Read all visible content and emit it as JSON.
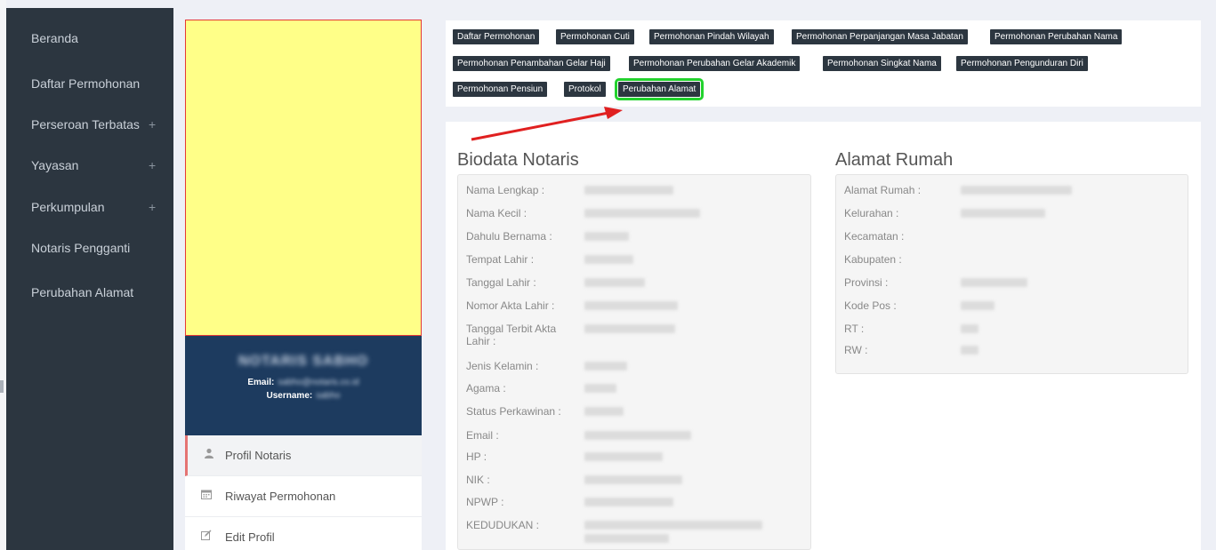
{
  "sidebar": {
    "items": [
      {
        "label": "Beranda",
        "expandable": false
      },
      {
        "label": "Daftar Permohonan",
        "expandable": false
      },
      {
        "label": "Perseroan Terbatas",
        "expandable": true
      },
      {
        "label": "Yayasan",
        "expandable": true
      },
      {
        "label": "Perkumpulan",
        "expandable": true
      },
      {
        "label": "Notaris Pengganti",
        "expandable": false
      },
      {
        "label": "Perubahan Alamat",
        "expandable": false
      }
    ],
    "plus_symbol": "+"
  },
  "profile": {
    "name": "NOTARIS SABHO",
    "email_label": "Email:",
    "email_value": "sabho@notaris.co.id",
    "username_label": "Username:",
    "username_value": "sabho",
    "menu": [
      {
        "label": "Profil Notaris",
        "icon": "user-icon",
        "active": true
      },
      {
        "label": "Riwayat Permohonan",
        "icon": "calendar-icon",
        "active": false
      },
      {
        "label": "Edit Profil",
        "icon": "edit-icon",
        "active": false
      }
    ]
  },
  "topnav": {
    "buttons": [
      "Daftar Permohonan",
      "Permohonan Cuti",
      "Permohonan Pindah Wilayah",
      "Permohonan Perpanjangan Masa Jabatan",
      "Permohonan Perubahan Nama",
      "Permohonan Penambahan Gelar Haji",
      "Permohonan Perubahan Gelar Akademik",
      "Permohonan Singkat Nama",
      "Permohonan Pengunduran Diri",
      "Permohonan Pensiun",
      "Protokol",
      "Perubahan Alamat"
    ],
    "highlighted": "Perubahan Alamat"
  },
  "biodata": {
    "title": "Biodata Notaris",
    "fields": [
      "Nama Lengkap :",
      "Nama Kecil :",
      "Dahulu Bernama :",
      "Tempat Lahir :",
      "Tanggal Lahir :",
      "Nomor Akta Lahir :",
      "Tanggal Terbit Akta Lahir :",
      "Jenis Kelamin :",
      "Agama :",
      "Status Perkawinan :",
      "Email :",
      "HP :",
      "NIK :",
      "NPWP :",
      "KEDUDUKAN :"
    ]
  },
  "alamat": {
    "title": "Alamat Rumah",
    "fields": [
      "Alamat Rumah :",
      "Kelurahan :",
      "Kecamatan :",
      "Kabupaten :",
      "Provinsi :",
      "Kode Pos :",
      "RT :",
      "RW :"
    ]
  },
  "colors": {
    "sidebar_bg": "#2c3640",
    "profile_card_bg": "#1d3b5f",
    "photo_bg": "#ffff88",
    "highlight": "#22d22d",
    "arrow": "#e02020"
  }
}
